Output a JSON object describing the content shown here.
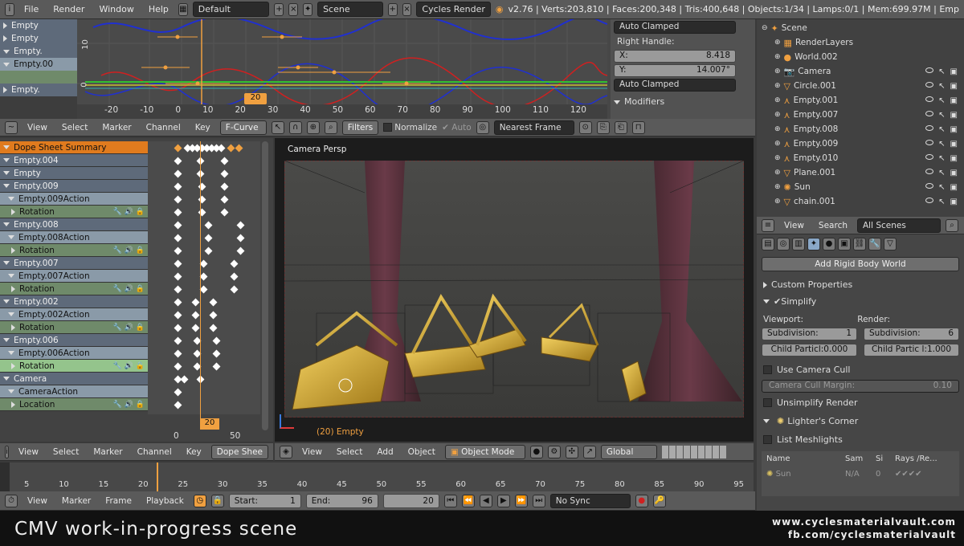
{
  "topbar": {
    "menus": [
      "File",
      "Render",
      "Window",
      "Help"
    ],
    "layout": "Default",
    "scene": "Scene",
    "engine": "Cycles Render",
    "stats": "v2.76 | Verts:203,810 | Faces:200,348 | Tris:400,648 | Objects:1/34 | Lamps:0/1 | Mem:699.97M | Emp"
  },
  "graph": {
    "channels": [
      "Empty",
      "Empty",
      "Empty.",
      "Empty.00",
      "Empty."
    ],
    "y_labels": [
      "10",
      "0"
    ],
    "x_ticks": [
      "-20",
      "-10",
      "0",
      "10",
      "20",
      "30",
      "40",
      "50",
      "60",
      "70",
      "80",
      "90",
      "100",
      "110",
      "120"
    ],
    "frame": "20",
    "side": {
      "handle_type_top": "Auto Clamped",
      "right_handle": "Right Handle:",
      "x_label": "X:",
      "x_val": "8.418",
      "y_label": "Y:",
      "y_val": "14.007°",
      "handle_type_bottom": "Auto Clamped",
      "modifiers": "Modifiers"
    },
    "header": {
      "view": "View",
      "select": "Select",
      "marker": "Marker",
      "channel": "Channel",
      "key": "Key",
      "mode": "F-Curve",
      "filters": "Filters",
      "normalize": "Normalize",
      "auto": "Auto",
      "snap": "Nearest Frame"
    }
  },
  "dopesheet": {
    "channels": [
      {
        "label": "Dope Sheet Summary",
        "kind": "sum"
      },
      {
        "label": "Empty.004",
        "kind": "obj"
      },
      {
        "label": "Empty",
        "kind": "obj"
      },
      {
        "label": "Empty.009",
        "kind": "obj"
      },
      {
        "label": "Empty.009Action",
        "kind": "act"
      },
      {
        "label": "Rotation",
        "kind": "fc"
      },
      {
        "label": "Empty.008",
        "kind": "obj"
      },
      {
        "label": "Empty.008Action",
        "kind": "act"
      },
      {
        "label": "Rotation",
        "kind": "fc"
      },
      {
        "label": "Empty.007",
        "kind": "obj"
      },
      {
        "label": "Empty.007Action",
        "kind": "act"
      },
      {
        "label": "Rotation",
        "kind": "fc"
      },
      {
        "label": "Empty.002",
        "kind": "obj"
      },
      {
        "label": "Empty.002Action",
        "kind": "act"
      },
      {
        "label": "Rotation",
        "kind": "fc"
      },
      {
        "label": "Empty.006",
        "kind": "obj"
      },
      {
        "label": "Empty.006Action",
        "kind": "act"
      },
      {
        "label": "Rotation",
        "kind": "sel"
      },
      {
        "label": "Camera",
        "kind": "obj"
      },
      {
        "label": "CameraAction",
        "kind": "act"
      },
      {
        "label": "Location",
        "kind": "fc"
      }
    ],
    "ticks": [
      "0",
      "50"
    ],
    "frame": "20",
    "header": {
      "view": "View",
      "select": "Select",
      "marker": "Marker",
      "channel": "Channel",
      "key": "Key",
      "mode": "Dope Shee"
    }
  },
  "viewport": {
    "title": "Camera Persp",
    "status": "(20) Empty",
    "header": {
      "view": "View",
      "select": "Select",
      "add": "Add",
      "object": "Object",
      "mode": "Object Mode",
      "orientation": "Global"
    }
  },
  "outliner": {
    "items": [
      {
        "label": "Scene",
        "indent": 0
      },
      {
        "label": "RenderLayers",
        "indent": 1
      },
      {
        "label": "World.002",
        "indent": 1
      },
      {
        "label": "Camera",
        "indent": 1
      },
      {
        "label": "Circle.001",
        "indent": 1
      },
      {
        "label": "Empty.001",
        "indent": 1
      },
      {
        "label": "Empty.007",
        "indent": 1
      },
      {
        "label": "Empty.008",
        "indent": 1
      },
      {
        "label": "Empty.009",
        "indent": 1
      },
      {
        "label": "Empty.010",
        "indent": 1
      },
      {
        "label": "Plane.001",
        "indent": 1
      },
      {
        "label": "Sun",
        "indent": 1
      },
      {
        "label": "chain.001",
        "indent": 1
      }
    ],
    "header": {
      "view": "View",
      "search": "Search",
      "scenes": "All Scenes"
    }
  },
  "properties": {
    "add_rigid": "Add Rigid Body World",
    "custom_props": "Custom Properties",
    "simplify": "Simplify",
    "viewport_label": "Viewport:",
    "render_label": "Render:",
    "subdiv_label": "Subdivision:",
    "subdiv_view": "1",
    "subdiv_render": "6",
    "child_view": "Child Particl:0.000",
    "child_render": "Child Partic l:1.000",
    "use_camera_cull": "Use Camera Cull",
    "cull_margin": "Camera Cull Margin:",
    "cull_margin_val": "0.10",
    "unsimplify": "Unsimplify Render",
    "lighters": "Lighter's Corner",
    "list_meshlights": "List Meshlights",
    "table_headers": [
      "Name",
      "Sam",
      "Si",
      "Rays /Re..."
    ],
    "table_row": [
      "Sun",
      "N/A",
      "0",
      ""
    ]
  },
  "timeline": {
    "ticks": [
      "5",
      "10",
      "15",
      "20",
      "25",
      "30",
      "35",
      "40",
      "45",
      "50",
      "55",
      "60",
      "65",
      "70",
      "75",
      "80",
      "85",
      "90",
      "95"
    ],
    "header": {
      "view": "View",
      "marker": "Marker",
      "frame": "Frame",
      "playback": "Playback",
      "start_label": "Start:",
      "start": "1",
      "end_label": "End:",
      "end": "96",
      "current": "20",
      "sync": "No Sync"
    }
  },
  "caption": {
    "title": "CMV work-in-progress scene",
    "site": "www.cyclesmaterialvault.com",
    "fb": "fb.com/cyclesmaterialvault"
  }
}
